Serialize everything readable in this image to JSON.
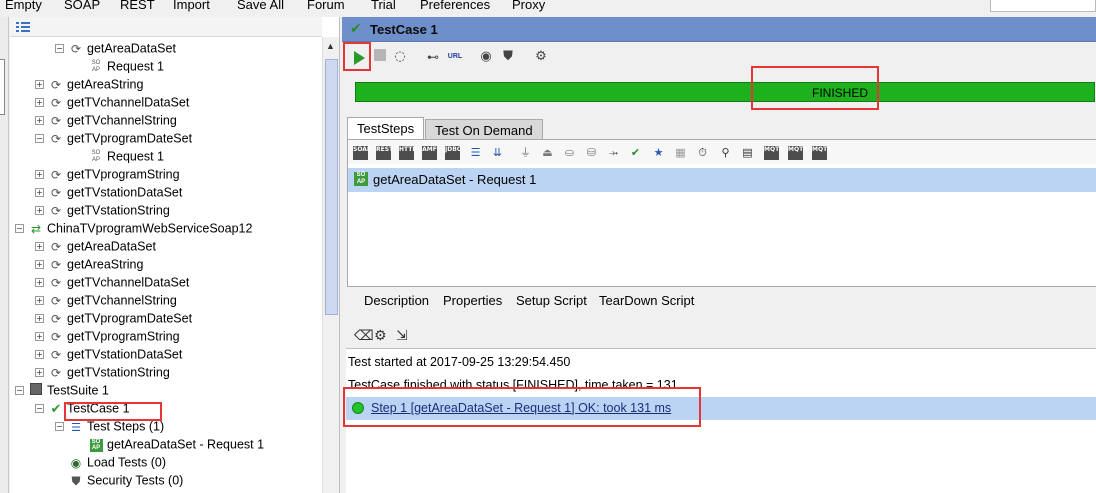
{
  "menu": [
    "Empty",
    "SOAP",
    "REST",
    "Import",
    "Save All",
    "Forum",
    "Trial",
    "Preferences",
    "Proxy"
  ],
  "tree": {
    "rows": [
      {
        "label": "getAreaDataSet",
        "icon": "operation-icon",
        "expand": "-"
      },
      {
        "label": "Request 1",
        "icon": "soap-request-icon",
        "expand": ""
      },
      {
        "label": "getAreaString",
        "icon": "operation-icon",
        "expand": "+"
      },
      {
        "label": "getTVchannelDataSet",
        "icon": "operation-icon",
        "expand": "+"
      },
      {
        "label": "getTVchannelString",
        "icon": "operation-icon",
        "expand": "+"
      },
      {
        "label": "getTVprogramDateSet",
        "icon": "operation-icon",
        "expand": "-"
      },
      {
        "label": "Request 1",
        "icon": "soap-request-icon",
        "expand": ""
      },
      {
        "label": "getTVprogramString",
        "icon": "operation-icon",
        "expand": "+"
      },
      {
        "label": "getTVstationDataSet",
        "icon": "operation-icon",
        "expand": "+"
      },
      {
        "label": "getTVstationString",
        "icon": "operation-icon",
        "expand": "+"
      },
      {
        "label": "ChinaTVprogramWebServiceSoap12",
        "icon": "interface-icon",
        "expand": "-"
      },
      {
        "label": "getAreaDataSet",
        "icon": "operation-icon",
        "expand": "+"
      },
      {
        "label": "getAreaString",
        "icon": "operation-icon",
        "expand": "+"
      },
      {
        "label": "getTVchannelDataSet",
        "icon": "operation-icon",
        "expand": "+"
      },
      {
        "label": "getTVchannelString",
        "icon": "operation-icon",
        "expand": "+"
      },
      {
        "label": "getTVprogramDateSet",
        "icon": "operation-icon",
        "expand": "+"
      },
      {
        "label": "getTVprogramString",
        "icon": "operation-icon",
        "expand": "+"
      },
      {
        "label": "getTVstationDataSet",
        "icon": "operation-icon",
        "expand": "+"
      },
      {
        "label": "getTVstationString",
        "icon": "operation-icon",
        "expand": "+"
      },
      {
        "label": "TestSuite 1",
        "icon": "testsuite-icon",
        "expand": "-"
      },
      {
        "label": "TestCase 1",
        "icon": "testcase-pass-icon",
        "expand": "-"
      },
      {
        "label": "Test Steps (1)",
        "icon": "teststeps-icon",
        "expand": "-"
      },
      {
        "label": "getAreaDataSet - Request 1",
        "icon": "soap-step-icon",
        "expand": ""
      },
      {
        "label": "Load Tests (0)",
        "icon": "loadtest-icon",
        "expand": ""
      },
      {
        "label": "Security Tests (0)",
        "icon": "securitytest-icon",
        "expand": ""
      }
    ]
  },
  "testcase": {
    "title": "TestCase 1",
    "status": "FINISHED",
    "progress": 1.0,
    "toolbar": {
      "url_label": "URL"
    },
    "tabs": [
      "TestSteps",
      "Test On Demand"
    ],
    "step": "getAreaDataSet - Request 1",
    "desc_tabs": [
      "Description",
      "Properties",
      "Setup Script",
      "TearDown Script"
    ],
    "log": {
      "started": "Test started at 2017-09-25 13:29:54.450",
      "finished": "TestCase finished with status [FINISHED], time taken = 131",
      "result": "Step 1 [getAreaDataSet - Request 1] OK: took 131 ms"
    }
  },
  "step_toolbar_tags": [
    "SOAP",
    "REST",
    "HTTP",
    "AMF",
    "JDBC"
  ],
  "step_toolbar_extra": [
    "MQTT",
    "MQTT",
    "MQTT"
  ],
  "colors": {
    "accent": "#6f8fca",
    "progress": "#1db21d",
    "selection": "#bcd4f3",
    "highlight_box": "#e53535"
  }
}
